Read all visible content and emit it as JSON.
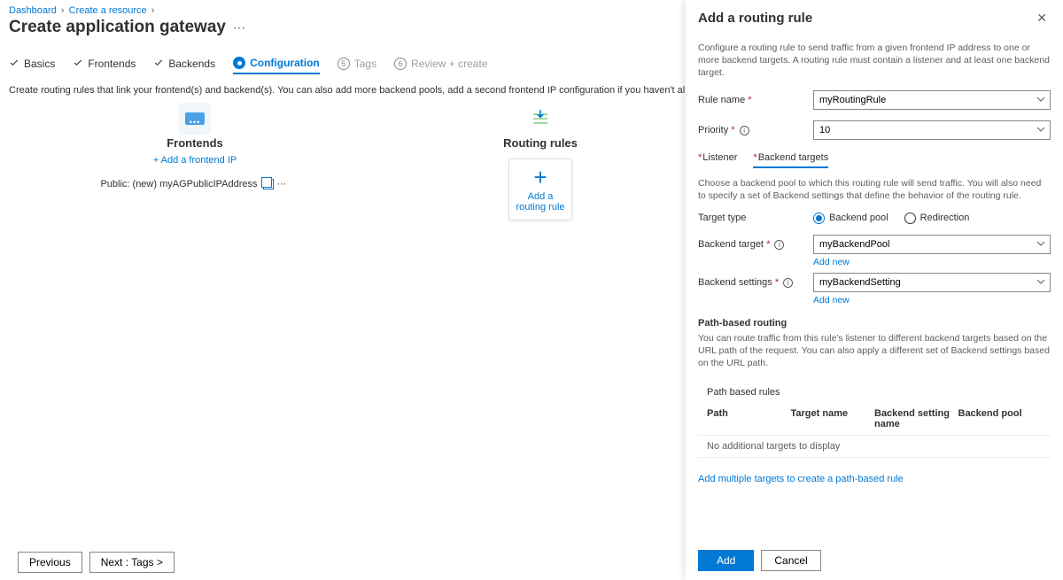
{
  "breadcrumb": {
    "items": [
      "Dashboard",
      "Create a resource"
    ]
  },
  "page_title": "Create application gateway",
  "tabs": {
    "basics": "Basics",
    "frontends": "Frontends",
    "backends": "Backends",
    "configuration": "Configuration",
    "tags_num": "5",
    "tags": "Tags",
    "review_num": "6",
    "review": "Review + create"
  },
  "description": "Create routing rules that link your frontend(s) and backend(s). You can also add more backend pools, add a second frontend IP configuration if you haven't already, or edit previous configurations.",
  "frontends_section": {
    "title": "Frontends",
    "add_link": "+ Add a frontend IP",
    "ip_label": "Public: (new) myAGPublicIPAddress"
  },
  "routing_section": {
    "title": "Routing rules",
    "add_card": "Add a routing rule"
  },
  "footer": {
    "previous": "Previous",
    "next": "Next : Tags >"
  },
  "panel": {
    "title": "Add a routing rule",
    "desc": "Configure a routing rule to send traffic from a given frontend IP address to one or more backend targets. A routing rule must contain a listener and at least one backend target.",
    "rule_name_label": "Rule name",
    "rule_name_value": "myRoutingRule",
    "priority_label": "Priority",
    "priority_value": "10",
    "tab_listener": "Listener",
    "tab_backend": "Backend targets",
    "backend_desc": "Choose a backend pool to which this routing rule will send traffic. You will also need to specify a set of Backend settings that define the behavior of the routing rule.",
    "target_type_label": "Target type",
    "target_type_pool": "Backend pool",
    "target_type_redirect": "Redirection",
    "backend_target_label": "Backend target",
    "backend_target_value": "myBackendPool",
    "backend_settings_label": "Backend settings",
    "backend_settings_value": "myBackendSetting",
    "add_new": "Add new",
    "path_routing_title": "Path-based routing",
    "path_routing_desc": "You can route traffic from this rule's listener to different backend targets based on the URL path of the request. You can also apply a different set of Backend settings based on the URL path.",
    "path_table_title": "Path based rules",
    "path_cols": {
      "path": "Path",
      "target": "Target name",
      "setting": "Backend setting name",
      "pool": "Backend pool"
    },
    "path_empty": "No additional targets to display",
    "add_multi": "Add multiple targets to create a path-based rule",
    "add_btn": "Add",
    "cancel_btn": "Cancel"
  }
}
